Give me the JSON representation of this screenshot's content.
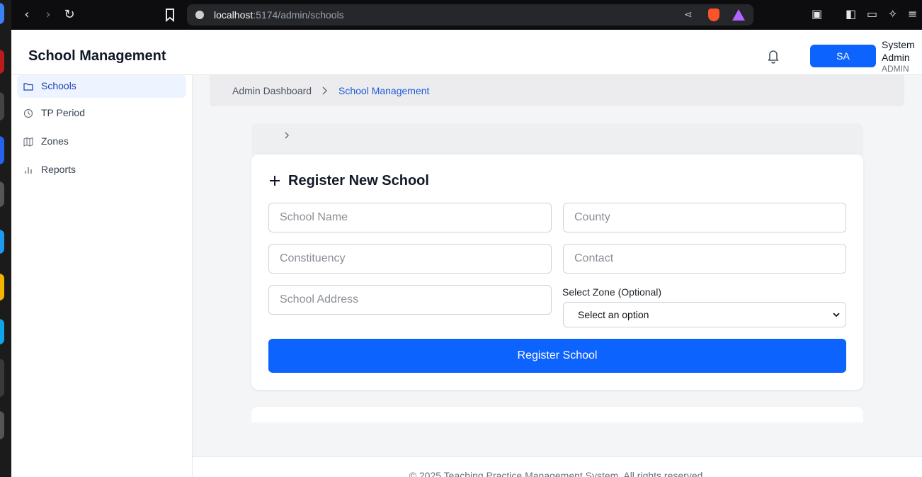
{
  "browser": {
    "url_host": "localhost",
    "url_rest": ":5174/admin/schools"
  },
  "header": {
    "title": "School Management",
    "avatar_initials": "SA",
    "user_name": "System Admin",
    "user_role": "ADMIN"
  },
  "sidebar": {
    "items": [
      {
        "label": "Schools",
        "icon": "folder-icon",
        "active": true
      },
      {
        "label": "TP Period",
        "icon": "clock-icon"
      },
      {
        "label": "Zones",
        "icon": "map-icon"
      },
      {
        "label": "Reports",
        "icon": "bar-chart-icon"
      }
    ]
  },
  "breadcrumb": {
    "parent": "Admin Dashboard",
    "current": "School Management"
  },
  "form": {
    "title": "Register New School",
    "school_name_placeholder": "School Name",
    "county_placeholder": "County",
    "constituency_placeholder": "Constituency",
    "contact_placeholder": "Contact",
    "address_placeholder": "School Address",
    "zone_label": "Select Zone (Optional)",
    "zone_selected": "Select an option",
    "submit_label": "Register School"
  },
  "footer": {
    "text": "© 2025 Teaching Practice Management System. All rights reserved."
  },
  "colors": {
    "primary": "#0d63fd",
    "breadcrumb_active": "#1d5bd8"
  }
}
